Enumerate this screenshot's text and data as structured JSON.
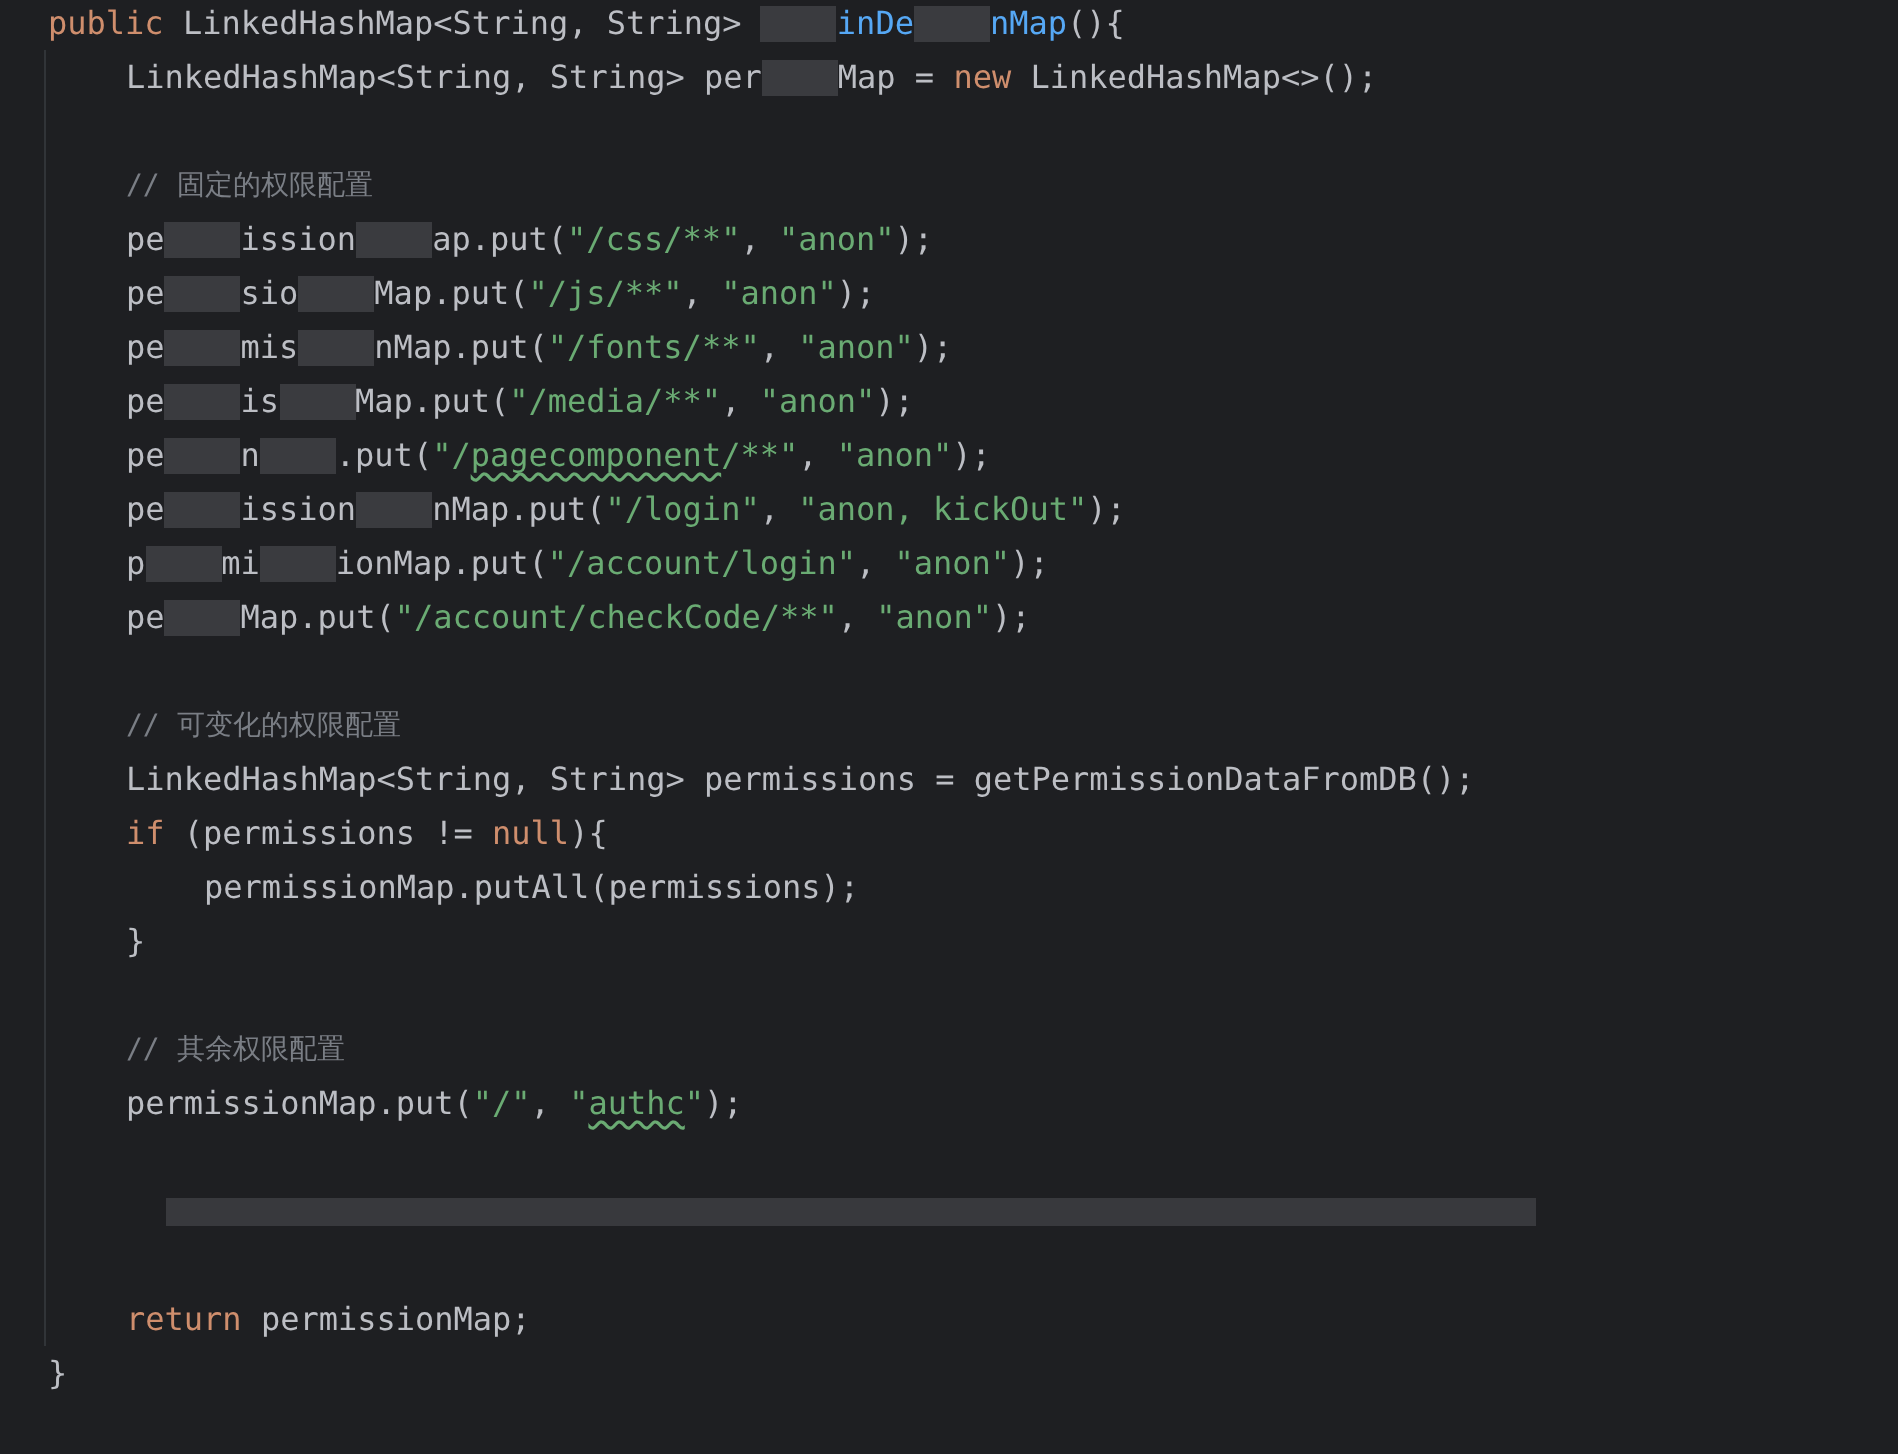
{
  "method": {
    "kind": "block",
    "tokens": [
      {
        "kind": "keyword",
        "t": "public "
      },
      {
        "kind": "plain",
        "t": "LinkedHashMap<String, String> "
      },
      {
        "kind": "redacted"
      },
      {
        "kind": "method",
        "t": "inDe"
      },
      {
        "kind": "redacted"
      },
      {
        "kind": "method",
        "t": "nMap"
      },
      {
        "kind": "plain",
        "t": "(){"
      }
    ],
    "children": [
      {
        "kind": "code",
        "tokens": [
          {
            "kind": "plain",
            "t": "LinkedHashMap<String, String> per"
          },
          {
            "kind": "redacted"
          },
          {
            "kind": "plain",
            "t": "Map = "
          },
          {
            "kind": "keyword",
            "t": "new "
          },
          {
            "kind": "plain",
            "t": "LinkedHashMap<>();"
          }
        ]
      },
      {
        "kind": "blank"
      },
      {
        "kind": "code",
        "tokens": [
          {
            "kind": "comment",
            "t": "// 固定的权限配置"
          }
        ]
      },
      {
        "kind": "code",
        "tokens": [
          {
            "kind": "plain",
            "t": "pe"
          },
          {
            "kind": "redacted"
          },
          {
            "kind": "plain",
            "t": "ission"
          },
          {
            "kind": "redacted"
          },
          {
            "kind": "plain",
            "t": "ap.put("
          },
          {
            "kind": "string",
            "t": "\"/css/**\""
          },
          {
            "kind": "plain",
            "t": ", "
          },
          {
            "kind": "string",
            "t": "\"anon\""
          },
          {
            "kind": "plain",
            "t": ");"
          }
        ]
      },
      {
        "kind": "code",
        "tokens": [
          {
            "kind": "plain",
            "t": "pe"
          },
          {
            "kind": "redacted"
          },
          {
            "kind": "plain",
            "t": "sio"
          },
          {
            "kind": "redacted"
          },
          {
            "kind": "plain",
            "t": "Map.put("
          },
          {
            "kind": "string",
            "t": "\"/js/**\""
          },
          {
            "kind": "plain",
            "t": ", "
          },
          {
            "kind": "string",
            "t": "\"anon\""
          },
          {
            "kind": "plain",
            "t": ");"
          }
        ]
      },
      {
        "kind": "code",
        "tokens": [
          {
            "kind": "plain",
            "t": "pe"
          },
          {
            "kind": "redacted"
          },
          {
            "kind": "plain",
            "t": "mis"
          },
          {
            "kind": "redacted"
          },
          {
            "kind": "plain",
            "t": "nMap.put("
          },
          {
            "kind": "string",
            "t": "\"/fonts/**\""
          },
          {
            "kind": "plain",
            "t": ", "
          },
          {
            "kind": "string",
            "t": "\"anon\""
          },
          {
            "kind": "plain",
            "t": ");"
          }
        ]
      },
      {
        "kind": "code",
        "tokens": [
          {
            "kind": "plain",
            "t": "pe"
          },
          {
            "kind": "redacted"
          },
          {
            "kind": "plain",
            "t": "is"
          },
          {
            "kind": "redacted"
          },
          {
            "kind": "plain",
            "t": "Map.put("
          },
          {
            "kind": "string",
            "t": "\"/media/**\""
          },
          {
            "kind": "plain",
            "t": ", "
          },
          {
            "kind": "string",
            "t": "\"anon\""
          },
          {
            "kind": "plain",
            "t": ");"
          }
        ]
      },
      {
        "kind": "code",
        "tokens": [
          {
            "kind": "plain",
            "t": "pe"
          },
          {
            "kind": "redacted"
          },
          {
            "kind": "plain",
            "t": "n"
          },
          {
            "kind": "redacted"
          },
          {
            "kind": "plain",
            "t": ".put("
          },
          {
            "kind": "string",
            "t": "\"/"
          },
          {
            "kind": "string",
            "t": "pagecomponent",
            "flagged": true
          },
          {
            "kind": "string",
            "t": "/**\""
          },
          {
            "kind": "plain",
            "t": ", "
          },
          {
            "kind": "string",
            "t": "\"anon\""
          },
          {
            "kind": "plain",
            "t": ");"
          }
        ]
      },
      {
        "kind": "code",
        "tokens": [
          {
            "kind": "plain",
            "t": "pe"
          },
          {
            "kind": "redacted"
          },
          {
            "kind": "plain",
            "t": "ission"
          },
          {
            "kind": "redacted"
          },
          {
            "kind": "plain",
            "t": "nMap.put("
          },
          {
            "kind": "string",
            "t": "\"/login\""
          },
          {
            "kind": "plain",
            "t": ", "
          },
          {
            "kind": "string",
            "t": "\"anon, kickOut\""
          },
          {
            "kind": "plain",
            "t": ");"
          }
        ]
      },
      {
        "kind": "code",
        "tokens": [
          {
            "kind": "plain",
            "t": "p"
          },
          {
            "kind": "redacted"
          },
          {
            "kind": "plain",
            "t": "mi"
          },
          {
            "kind": "redacted"
          },
          {
            "kind": "plain",
            "t": "ionMap.put("
          },
          {
            "kind": "string",
            "t": "\"/account/login\""
          },
          {
            "kind": "plain",
            "t": ", "
          },
          {
            "kind": "string",
            "t": "\"anon\""
          },
          {
            "kind": "plain",
            "t": ");"
          }
        ]
      },
      {
        "kind": "code",
        "tokens": [
          {
            "kind": "plain",
            "t": "pe"
          },
          {
            "kind": "redacted"
          },
          {
            "kind": "plain",
            "t": "Map.put("
          },
          {
            "kind": "string",
            "t": "\"/account/checkCode/**\""
          },
          {
            "kind": "plain",
            "t": ", "
          },
          {
            "kind": "string",
            "t": "\"anon\""
          },
          {
            "kind": "plain",
            "t": ");"
          }
        ]
      },
      {
        "kind": "blank"
      },
      {
        "kind": "code",
        "tokens": [
          {
            "kind": "comment",
            "t": "// 可变化的权限配置"
          }
        ]
      },
      {
        "kind": "code",
        "tokens": [
          {
            "kind": "plain",
            "t": "LinkedHashMap<String, String> permissions = getPermissionDataFromDB();"
          }
        ]
      },
      {
        "kind": "block",
        "tokens": [
          {
            "kind": "keyword",
            "t": "if "
          },
          {
            "kind": "plain",
            "t": "(permissions != "
          },
          {
            "kind": "keyword",
            "t": "null"
          },
          {
            "kind": "plain",
            "t": "){"
          }
        ],
        "children": [
          {
            "kind": "code",
            "tokens": [
              {
                "kind": "plain",
                "t": "permissionMap.putAll(permissions);"
              }
            ]
          }
        ],
        "closing": "}"
      },
      {
        "kind": "blank"
      },
      {
        "kind": "code",
        "tokens": [
          {
            "kind": "comment",
            "t": "// 其余权限配置"
          }
        ]
      },
      {
        "kind": "code",
        "tokens": [
          {
            "kind": "plain",
            "t": "permissionMap.put("
          },
          {
            "kind": "string",
            "t": "\"/\""
          },
          {
            "kind": "plain",
            "t": ", "
          },
          {
            "kind": "string",
            "t": "\""
          },
          {
            "kind": "string",
            "t": "authc",
            "flagged": true
          },
          {
            "kind": "string",
            "t": "\""
          },
          {
            "kind": "plain",
            "t": ");"
          }
        ]
      },
      {
        "kind": "blank"
      },
      {
        "kind": "redacted_line"
      },
      {
        "kind": "blank"
      },
      {
        "kind": "code",
        "tokens": [
          {
            "kind": "keyword",
            "t": "return "
          },
          {
            "kind": "plain",
            "t": "permissionMap;"
          }
        ]
      }
    ],
    "closing": "}"
  }
}
